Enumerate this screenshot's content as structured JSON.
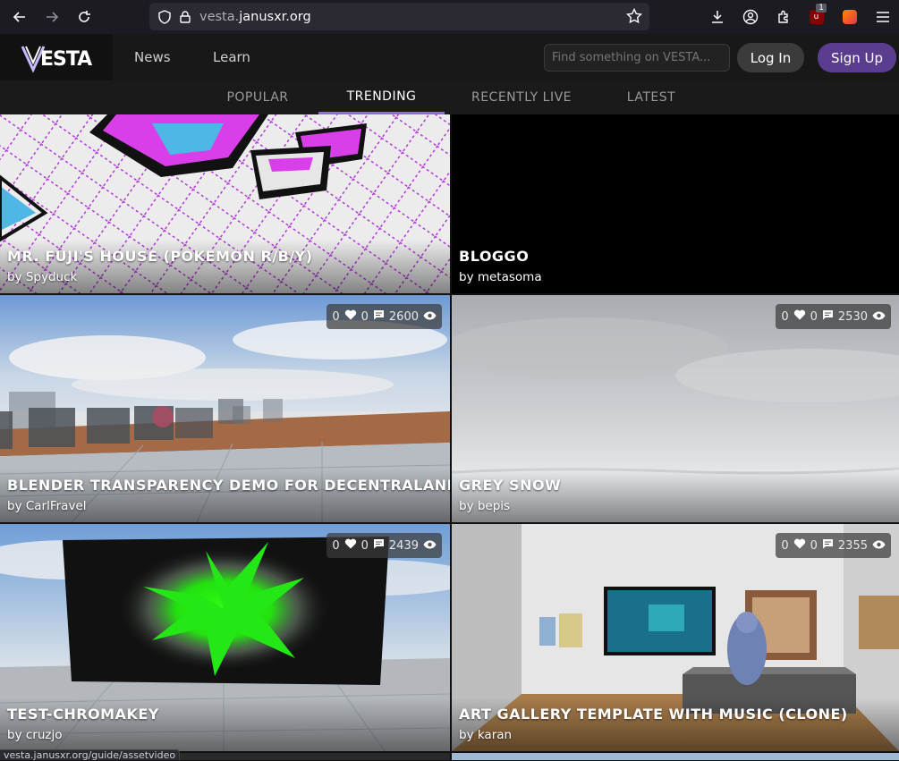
{
  "browser": {
    "url_domain": "vesta.",
    "url_host": "janusxr.org",
    "ublock_count": "1"
  },
  "header": {
    "logo": "VESTA",
    "nav": [
      {
        "label": "News"
      },
      {
        "label": "Learn"
      }
    ],
    "search_placeholder": "Find something on VESTA...",
    "login_label": "Log In",
    "signup_label": "Sign Up"
  },
  "tabs": [
    {
      "label": "POPULAR"
    },
    {
      "label": "TRENDING"
    },
    {
      "label": "RECENTLY LIVE"
    },
    {
      "label": "LATEST"
    }
  ],
  "cards": [
    {
      "title": "MR. FUJI'S HOUSE (POKEMON R/B/Y)",
      "author": "by Spyduck"
    },
    {
      "title": "BLOGGO",
      "author": "by metasoma"
    },
    {
      "title": "BLENDER TRANSPARENCY DEMO FOR DECENTRALAND",
      "author": "by CarlFravel",
      "likes": "0",
      "comments": "0",
      "views": "2600"
    },
    {
      "title": "GREY SNOW",
      "author": "by bepis",
      "likes": "0",
      "comments": "0",
      "views": "2530"
    },
    {
      "title": "TEST-CHROMAKEY",
      "author": "by cruzjo",
      "likes": "0",
      "comments": "0",
      "views": "2439"
    },
    {
      "title": "ART GALLERY TEMPLATE WITH MUSIC (CLONE)",
      "author": "by karan",
      "likes": "0",
      "comments": "0",
      "views": "2355"
    }
  ],
  "status_url": "vesta.janusxr.org/guide/assetvideo",
  "colors": {
    "accent": "#8a6ed8",
    "signup": "#5b3d8f"
  }
}
